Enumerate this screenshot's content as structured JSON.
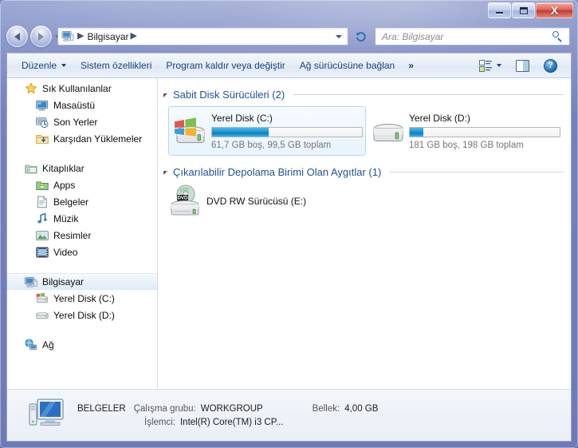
{
  "window": {
    "title": "Bilgisayar",
    "buttons": {
      "minimize": "–",
      "maximize": "□",
      "close": "X"
    }
  },
  "nav": {
    "back_title": "Geri",
    "forward_title": "İleri",
    "breadcrumb": [
      "Bilgisayar"
    ],
    "refresh_glyph": "↻",
    "search_placeholder": "Ara: Bilgisayar",
    "search_value": ""
  },
  "toolbar": {
    "items": [
      {
        "label": "Düzenle",
        "has_caret": true
      },
      {
        "label": "Sistem özellikleri",
        "has_caret": false
      },
      {
        "label": "Program kaldır veya değiştir",
        "has_caret": false
      },
      {
        "label": "Ağ sürücüsüne bağlan",
        "has_caret": false
      }
    ],
    "overflow": "»",
    "help_glyph": "?"
  },
  "sidebar": {
    "groups": [
      {
        "header": {
          "label": "Sık Kullanılanlar",
          "icon": "star-icon"
        },
        "items": [
          {
            "label": "Masaüstü",
            "icon": "desktop-icon"
          },
          {
            "label": "Son Yerler",
            "icon": "recent-places-icon"
          },
          {
            "label": "Karşıdan Yüklemeler",
            "icon": "downloads-icon"
          }
        ]
      },
      {
        "header": {
          "label": "Kitaplıklar",
          "icon": "libraries-icon"
        },
        "items": [
          {
            "label": "Apps",
            "icon": "apps-folder-icon"
          },
          {
            "label": "Belgeler",
            "icon": "documents-icon"
          },
          {
            "label": "Müzik",
            "icon": "music-icon"
          },
          {
            "label": "Resimler",
            "icon": "pictures-icon"
          },
          {
            "label": "Video",
            "icon": "video-icon"
          }
        ]
      },
      {
        "header": {
          "label": "Bilgisayar",
          "icon": "computer-icon",
          "selected": true
        },
        "items": [
          {
            "label": "Yerel Disk (C:)",
            "icon": "system-drive-icon"
          },
          {
            "label": "Yerel Disk (D:)",
            "icon": "drive-icon"
          }
        ]
      },
      {
        "header": {
          "label": "Ağ",
          "icon": "network-icon"
        },
        "items": []
      }
    ]
  },
  "content": {
    "sections": [
      {
        "title": "Sabit Disk Sürücüleri (2)",
        "kind": "drives",
        "drives": [
          {
            "name": "Yerel Disk (C:)",
            "free_total": "61,7 GB boş, 99,5 GB toplam",
            "used_percent": 38,
            "selected": true,
            "icon": "system-drive-icon"
          },
          {
            "name": "Yerel Disk (D:)",
            "free_total": "181 GB boş, 198 GB toplam",
            "used_percent": 9,
            "selected": false,
            "icon": "drive-icon"
          }
        ]
      },
      {
        "title": "Çıkarılabilir Depolama Birimi Olan Aygıtlar (1)",
        "kind": "removable",
        "devices": [
          {
            "name": "DVD RW Sürücüsü (E:)",
            "icon": "dvd-drive-icon",
            "badge": "DVD"
          }
        ]
      }
    ]
  },
  "status": {
    "computer_name": "BELGELER",
    "workgroup_label": "Çalışma grubu:",
    "workgroup_value": "WORKGROUP",
    "memory_label": "Bellek:",
    "memory_value": "4,00 GB",
    "processor_label": "İşlemci:",
    "processor_value": "Intel(R) Core(TM) i3 CP..."
  },
  "colors": {
    "accent_blue": "#1c5294",
    "bar_fill": "#1d9ad6",
    "glass": "#7581bd",
    "close_red": "#c03a2c"
  }
}
